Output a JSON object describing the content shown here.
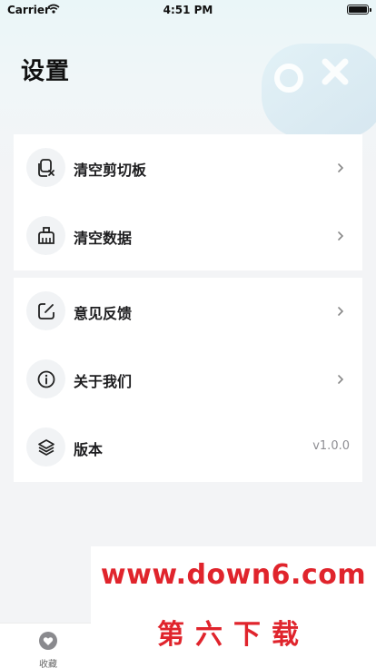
{
  "status_bar": {
    "carrier": "Carrier",
    "time": "4:51 PM"
  },
  "page": {
    "title": "设置"
  },
  "settings_group_1": [
    {
      "label": "清空剪切板",
      "icon": "clipboard-clear-icon"
    },
    {
      "label": "清空数据",
      "icon": "clear-data-icon"
    }
  ],
  "settings_group_2": [
    {
      "label": "意见反馈",
      "icon": "feedback-edit-icon"
    },
    {
      "label": "关于我们",
      "icon": "info-icon"
    },
    {
      "label": "版本",
      "icon": "layers-icon",
      "value": "v1.0.0"
    }
  ],
  "tab_bar": {
    "favorites_label": "收藏"
  },
  "watermark": {
    "url": "www.down6.com",
    "name": "第六下载"
  },
  "colors": {
    "accent": "#e0242c",
    "background": "#f3f4f6",
    "card": "#ffffff"
  }
}
